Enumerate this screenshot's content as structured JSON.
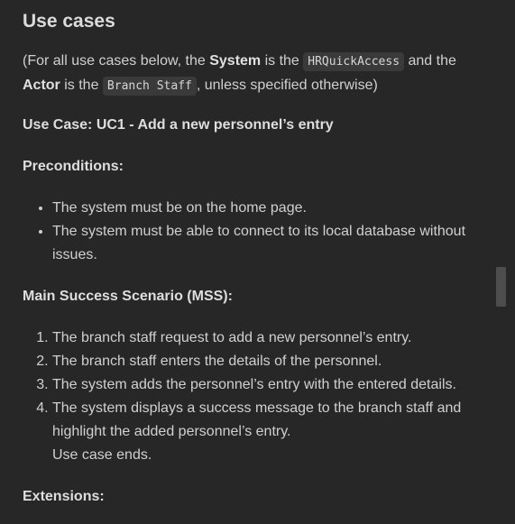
{
  "heading": "Use cases",
  "intro": {
    "part1": "(For all use cases below, the ",
    "system_label": "System",
    "part2": " is the ",
    "system_code": "HRQuickAccess",
    "part3": " and the ",
    "actor_label": "Actor",
    "part4": " is the ",
    "actor_code": "Branch Staff",
    "part5": ", unless specified otherwise)"
  },
  "use_case_title": "Use Case: UC1 - Add a new personnel’s entry",
  "preconditions": {
    "title": "Preconditions:",
    "items": [
      "The system must be on the home page.",
      "The system must be able to connect to its local database without issues."
    ]
  },
  "mss": {
    "title": "Main Success Scenario (MSS):",
    "steps": [
      "The branch staff request to add a new personnel’s entry.",
      "The branch staff enters the details of the personnel.",
      "The system adds the personnel’s entry with the entered details.",
      "The system displays a success message to the branch staff and highlight the added personnel’s entry."
    ],
    "ending": "Use case ends."
  },
  "extensions_title": "Extensions:"
}
